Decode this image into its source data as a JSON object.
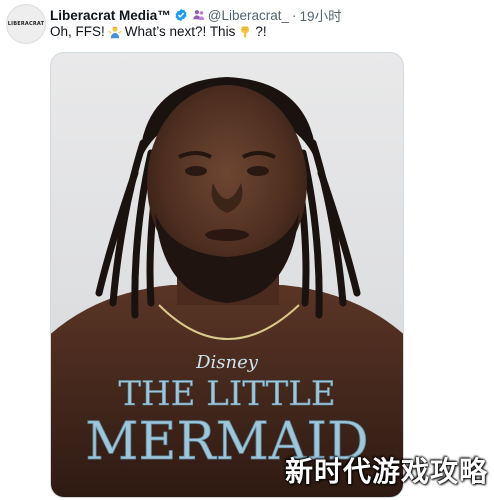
{
  "tweet": {
    "avatar_text": "LIBERACRAT",
    "display_name": "Liberacrat Media™",
    "handle": "@Liberacrat_",
    "separator": "·",
    "time": "19小时",
    "text_part1": "Oh, FFS!",
    "text_part2": "What’s next?! This",
    "text_part3": "?!"
  },
  "media": {
    "brand": "Disney",
    "title_line1": "THE LITTLE",
    "title_line2": "MERMAID"
  },
  "watermark": "新时代游戏攻略",
  "colors": {
    "verified": "#1d9bf0",
    "muted": "#536471",
    "title": "#9fc5d8"
  }
}
